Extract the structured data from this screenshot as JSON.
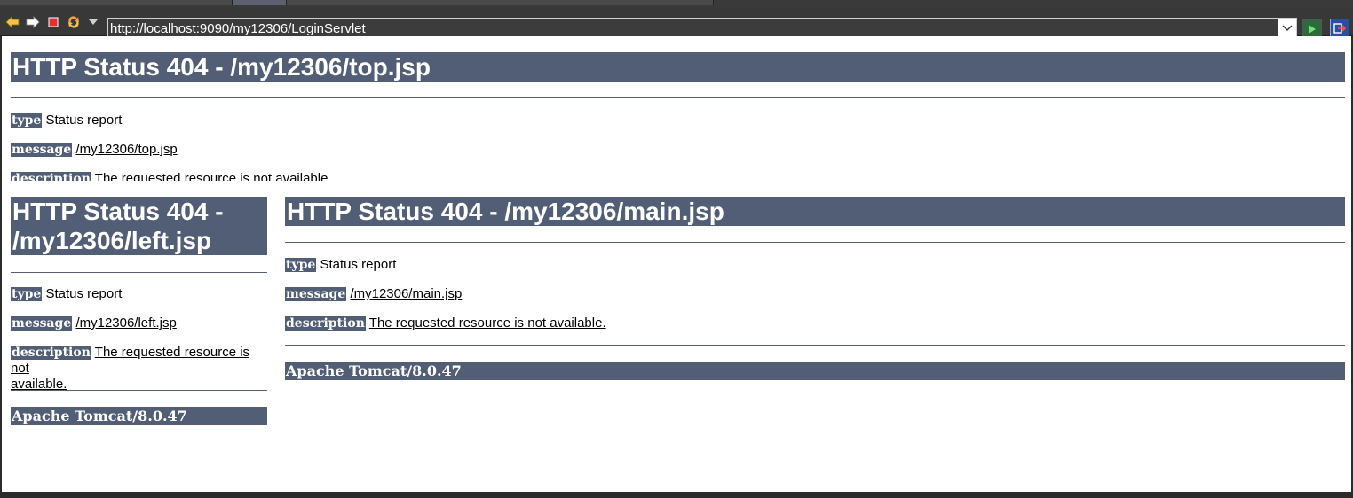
{
  "browser": {
    "url": "http://localhost:9090/my12306/LoginServlet",
    "icons": [
      "back-arrow-icon",
      "forward-arrow-icon",
      "stop-icon",
      "refresh-icon",
      "dropdown-icon",
      "go-icon",
      "external-icon"
    ]
  },
  "frames": {
    "top": {
      "title": "HTTP Status 404 - /my12306/top.jsp",
      "type_label": "type",
      "type_value": "Status report",
      "message_label": "message",
      "message_value": "/my12306/top.jsp",
      "description_label": "description",
      "description_value": "The requested resource is not available."
    },
    "left": {
      "title_line1": "HTTP Status 404 -",
      "title_line2": "/my12306/left.jsp",
      "type_label": "type",
      "type_value": "Status report",
      "message_label": "message",
      "message_value": "/my12306/left.jsp",
      "description_label": "description",
      "description_value_line1": "The requested resource is not",
      "description_value_line2": "available.",
      "server": "Apache Tomcat/8.0.47"
    },
    "main": {
      "title": "HTTP Status 404 - /my12306/main.jsp",
      "type_label": "type",
      "type_value": "Status report",
      "message_label": "message",
      "message_value": "/my12306/main.jsp",
      "description_label": "description",
      "description_value": "The requested resource is not available.",
      "server": "Apache Tomcat/8.0.47"
    }
  },
  "colors": {
    "header_bg": "#525d76",
    "toolbar_bg": "#383838"
  }
}
